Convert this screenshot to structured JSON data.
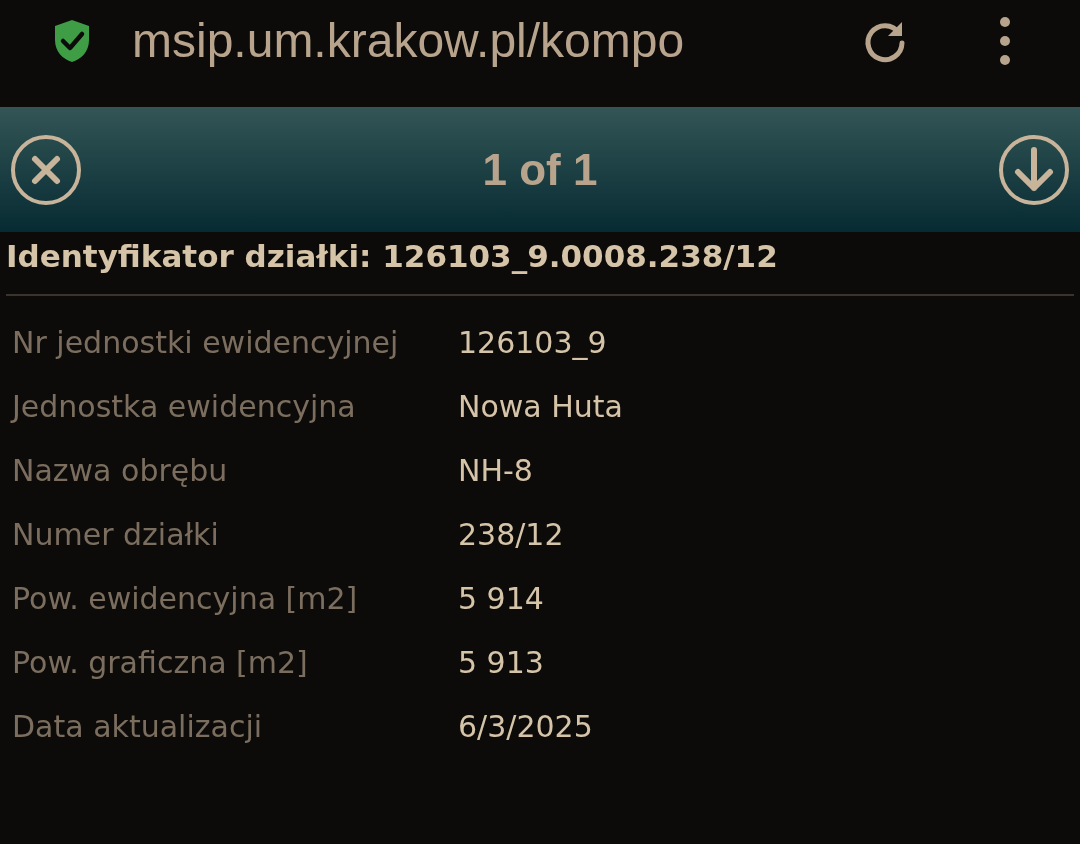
{
  "browser": {
    "url": "msip.um.krakow.pl/kompo"
  },
  "popup": {
    "pager": "1 of 1",
    "title": "Identyfikator działki: 126103_9.0008.238/12"
  },
  "fields": [
    {
      "label": "Nr jednostki ewidencyjnej",
      "value": "126103_9"
    },
    {
      "label": "Jednostka ewidencyjna",
      "value": "Nowa Huta"
    },
    {
      "label": "Nazwa obrębu",
      "value": "NH-8"
    },
    {
      "label": "Numer działki",
      "value": "238/12"
    },
    {
      "label": "Pow. ewidencyjna [m2]",
      "value": "5 914"
    },
    {
      "label": "Pow. graficzna [m2]",
      "value": "5 913"
    },
    {
      "label": "Data aktualizacji",
      "value": "6/3/2025"
    }
  ]
}
